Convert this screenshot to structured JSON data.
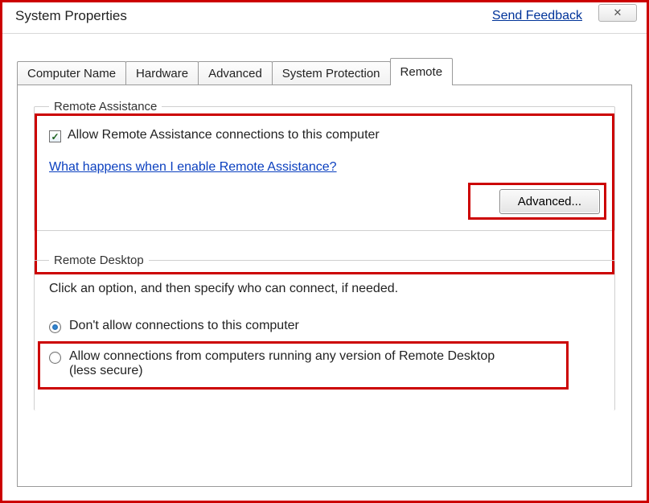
{
  "window": {
    "title": "System Properties",
    "feedback": "Send Feedback"
  },
  "tabs": [
    {
      "label": "Computer Name"
    },
    {
      "label": "Hardware"
    },
    {
      "label": "Advanced"
    },
    {
      "label": "System Protection"
    },
    {
      "label": "Remote"
    }
  ],
  "remote_assistance": {
    "legend": "Remote Assistance",
    "allow_label": "Allow Remote Assistance connections to this computer",
    "allow_checked": true,
    "help_link": "What happens when I enable Remote Assistance?",
    "advanced_button": "Advanced..."
  },
  "remote_desktop": {
    "legend": "Remote Desktop",
    "description": "Click an option, and then specify who can connect, if needed.",
    "options": [
      {
        "label": "Don't allow connections to this computer",
        "selected": true
      },
      {
        "label": "Allow connections from computers running any version of Remote Desktop (less secure)",
        "selected": false
      }
    ]
  }
}
